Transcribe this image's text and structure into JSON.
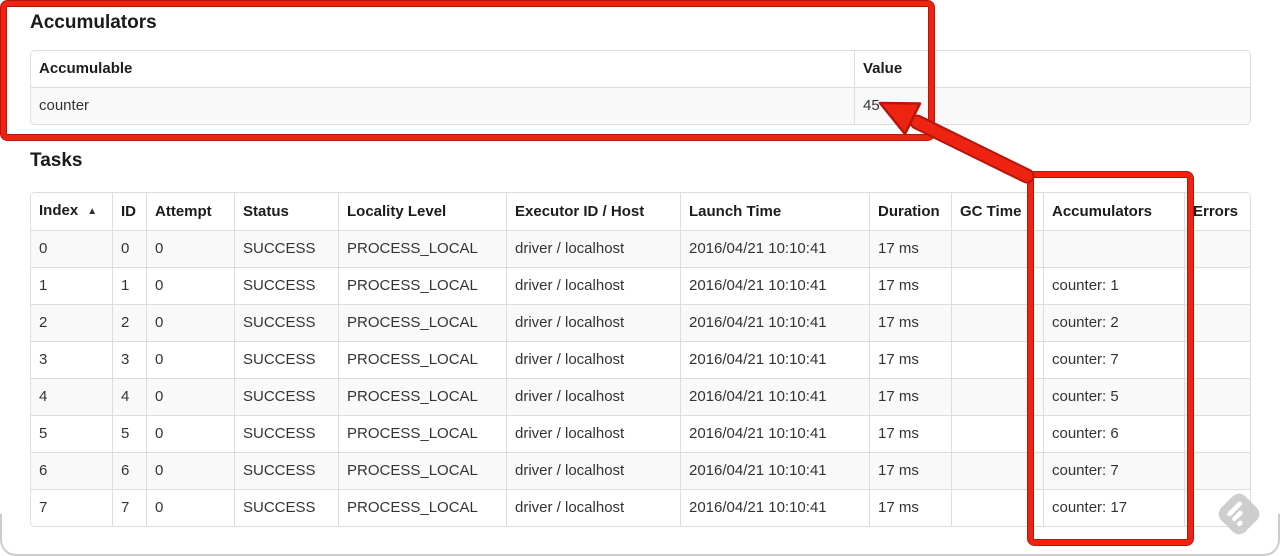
{
  "accumulators_section": {
    "heading": "Accumulators",
    "table": {
      "headers": [
        "Accumulable",
        "Value"
      ],
      "rows": [
        [
          "counter",
          "45"
        ]
      ]
    }
  },
  "tasks_section": {
    "heading": "Tasks",
    "table": {
      "headers": [
        "Index",
        "ID",
        "Attempt",
        "Status",
        "Locality Level",
        "Executor ID / Host",
        "Launch Time",
        "Duration",
        "GC Time",
        "Accumulators",
        "Errors"
      ],
      "sort": {
        "column": "Index",
        "direction": "ascending",
        "indicator": "▲"
      },
      "rows": [
        [
          "0",
          "0",
          "0",
          "SUCCESS",
          "PROCESS_LOCAL",
          "driver / localhost",
          "2016/04/21 10:10:41",
          "17 ms",
          "",
          "",
          ""
        ],
        [
          "1",
          "1",
          "0",
          "SUCCESS",
          "PROCESS_LOCAL",
          "driver / localhost",
          "2016/04/21 10:10:41",
          "17 ms",
          "",
          "counter: 1",
          ""
        ],
        [
          "2",
          "2",
          "0",
          "SUCCESS",
          "PROCESS_LOCAL",
          "driver / localhost",
          "2016/04/21 10:10:41",
          "17 ms",
          "",
          "counter: 2",
          ""
        ],
        [
          "3",
          "3",
          "0",
          "SUCCESS",
          "PROCESS_LOCAL",
          "driver / localhost",
          "2016/04/21 10:10:41",
          "17 ms",
          "",
          "counter: 7",
          ""
        ],
        [
          "4",
          "4",
          "0",
          "SUCCESS",
          "PROCESS_LOCAL",
          "driver / localhost",
          "2016/04/21 10:10:41",
          "17 ms",
          "",
          "counter: 5",
          ""
        ],
        [
          "5",
          "5",
          "0",
          "SUCCESS",
          "PROCESS_LOCAL",
          "driver / localhost",
          "2016/04/21 10:10:41",
          "17 ms",
          "",
          "counter: 6",
          ""
        ],
        [
          "6",
          "6",
          "0",
          "SUCCESS",
          "PROCESS_LOCAL",
          "driver / localhost",
          "2016/04/21 10:10:41",
          "17 ms",
          "",
          "counter: 7",
          ""
        ],
        [
          "7",
          "7",
          "0",
          "SUCCESS",
          "PROCESS_LOCAL",
          "driver / localhost",
          "2016/04/21 10:10:41",
          "17 ms",
          "",
          "counter: 17",
          ""
        ]
      ]
    }
  },
  "annotations": {
    "highlight_color": "#ee2312",
    "highlight_outline_color": "#b8150a"
  },
  "watermark": {
    "icon": "skitch-watermark-icon",
    "color": "#c9c9c9"
  }
}
